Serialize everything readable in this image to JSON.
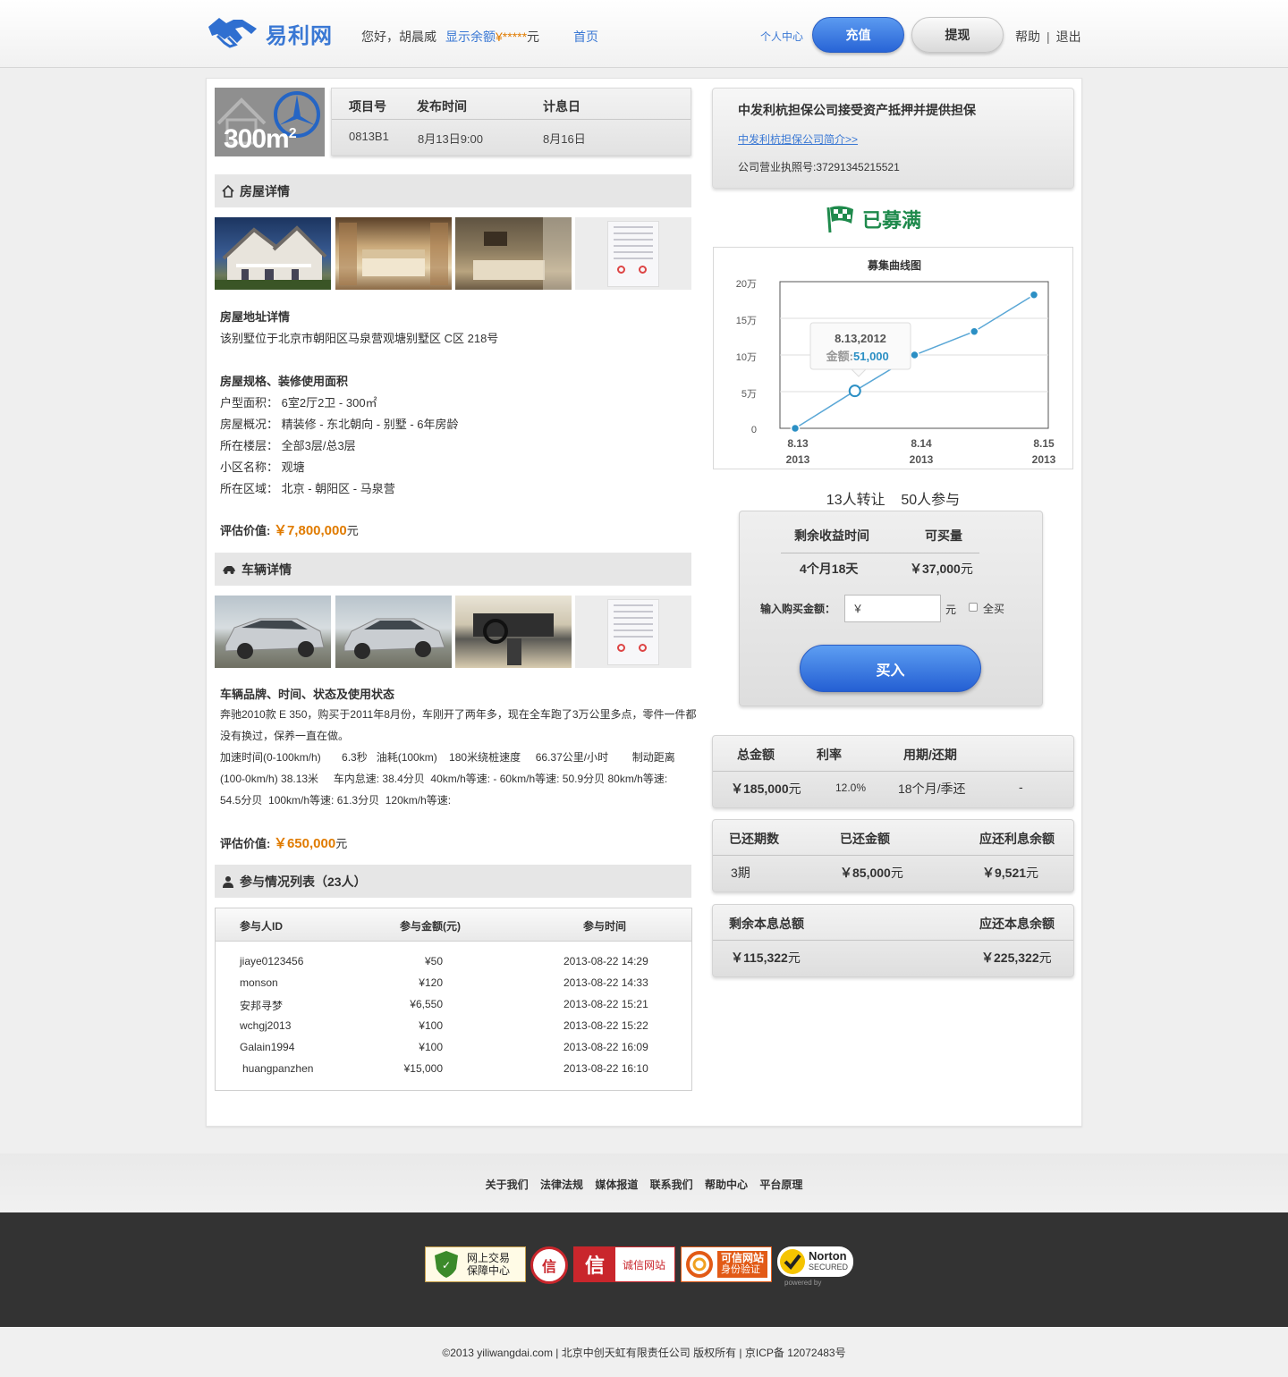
{
  "header": {
    "logo_text": "易利网",
    "greeting": "您好，胡晨威",
    "balance_label": "显示余额",
    "balance_symbol": "¥",
    "balance_mask": "*****",
    "balance_unit": "元",
    "home": "首页",
    "user_center": "个人中心",
    "recharge": "充值",
    "withdraw": "提现",
    "help": "帮助",
    "sep": "|",
    "logout": "退出"
  },
  "project": {
    "image_text": "300m",
    "image_sup": "2",
    "headers": [
      "项目号",
      "发布时间",
      "计息日"
    ],
    "values": [
      "0813B1",
      "8月13日9:00",
      "8月16日"
    ]
  },
  "house": {
    "title": "房屋详情",
    "addr_title": "房屋地址详情",
    "addr": "该别墅位于北京市朝阳区马泉营观塘别墅区 C区 218号",
    "spec_title": "房屋规格、装修使用面积",
    "specs": [
      "户型面积： 6室2厅2卫 - 300㎡",
      "房屋概况： 精装修 - 东北朝向 - 别墅 - 6年房龄",
      "所在楼层： 全部3层/总3层",
      "小区名称： 观塘",
      "所在区域： 北京 - 朝阳区 - 马泉营"
    ],
    "value_label": "评估价值:",
    "value": "￥7,800,000",
    "value_unit": "元"
  },
  "car": {
    "title": "车辆详情",
    "desc_title": "车辆品牌、时间、状态及使用状态",
    "desc_lines": [
      "奔驰2010款 E 350，购买于2011年8月份，车刚开了两年多，现在全车跑了3万公里多点，零件一件都",
      "没有换过，保养一直在做。",
      "加速时间(0-100km/h)       6.3秒   油耗(100km)    180米绕桩速度     66.37公里/小时        制动距离",
      "(100-0km/h) 38.13米     车内怠速: 38.4分贝  40km/h等速: - 60km/h等速: 50.9分贝 80km/h等速:",
      "54.5分贝  100km/h等速: 61.3分贝  120km/h等速:"
    ],
    "value_label": "评估价值:",
    "value": "￥650,000",
    "value_unit": "元"
  },
  "participants": {
    "title": "参与情况列表（23人）",
    "headers": [
      "参与人ID",
      "参与金额(元)",
      "参与时间"
    ],
    "rows": [
      [
        "jiaye0123456",
        "¥50",
        "2013-08-22 14:29"
      ],
      [
        "monson",
        "¥120",
        "2013-08-22 14:33"
      ],
      [
        "安邦寻梦",
        "¥6,550",
        "2013-08-22 15:21"
      ],
      [
        "wchgj2013",
        "¥100",
        "2013-08-22 15:22"
      ],
      [
        "Galain1994",
        "¥100",
        "2013-08-22 16:09"
      ],
      [
        "huangpanzhen",
        "¥15,000",
        "2013-08-22 16:10"
      ]
    ]
  },
  "guarantee": {
    "title": "中发利杭担保公司接受资产抵押并提供担保",
    "link": "中发利杭担保公司简介>>",
    "license": "公司营业执照号:37291345215521"
  },
  "status": "已募满",
  "chart_data": {
    "type": "line",
    "title": "募集曲线图",
    "yticks": [
      "20万",
      "15万",
      "10万",
      "5万",
      "0"
    ],
    "ylim": [
      0,
      200000
    ],
    "xticks": [
      [
        "8.13",
        "2013"
      ],
      [
        "8.14",
        "2013"
      ],
      [
        "8.15",
        "2013"
      ]
    ],
    "series": [
      {
        "values": [
          0,
          51000,
          100000,
          132000,
          182000
        ]
      }
    ],
    "tooltip": {
      "date": "8.13,2012",
      "label": "金额:",
      "value": "51,000"
    },
    "colors": {
      "line": "#5aa7d6",
      "point": "#2b8fc4"
    }
  },
  "stats": "13人转让    50人参与",
  "buy": {
    "h1": "剩余收益时间",
    "h2": "可买量",
    "v1": "4个月18天",
    "v2": "￥37,000",
    "v2_unit": "元",
    "input_label": "输入购买金额：",
    "input_value": "￥",
    "unit": "元",
    "all": "全买",
    "button": "买入"
  },
  "summary1": {
    "headers": [
      "总金额",
      "利率",
      "用期/还期"
    ],
    "values": [
      "￥185,000",
      "12.0%",
      "18个月/季还",
      "-"
    ],
    "unit": "元"
  },
  "summary2": {
    "headers": [
      "已还期数",
      "已还金额",
      "应还利息余额"
    ],
    "values": [
      "3期",
      "￥85,000",
      "￥9,521"
    ],
    "unit": "元"
  },
  "summary3": {
    "headers": [
      "剩余本息总额",
      "应还本息余额"
    ],
    "values": [
      "￥115,322",
      "￥225,322"
    ],
    "unit": "元"
  },
  "footer": {
    "links": [
      "关于我们",
      "法律法规",
      "媒体报道",
      "联系我们",
      "帮助中心",
      "平台原理"
    ],
    "badges": {
      "b1_line1": "网上交易",
      "b1_line2": "保障中心",
      "b2": "信",
      "b3": "诚信网站",
      "b4_line1": "可信网站",
      "b4_line2": "身份验证",
      "b5_title": "Norton",
      "b5_sub": "SECURED",
      "b5_powered": "powered by"
    },
    "copyright": "©2013 yiliwangdai.com | 北京中创天虹有限责任公司 版权所有 | 京ICP备 12072483号"
  }
}
